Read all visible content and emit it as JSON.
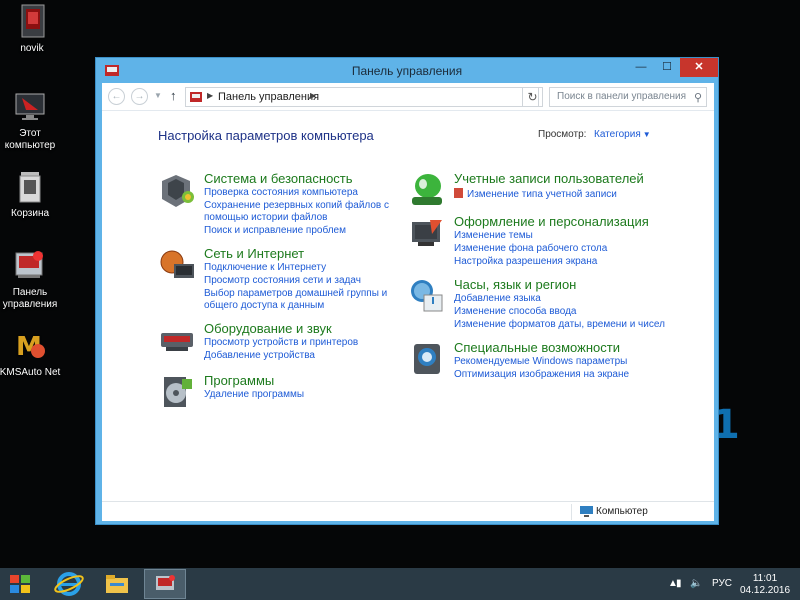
{
  "desktop": {
    "icons": [
      {
        "label": "novik"
      },
      {
        "label": "Этот компьютер"
      },
      {
        "label": "Корзина"
      },
      {
        "label": "Панель управления"
      },
      {
        "label": "KMSAuto Net"
      }
    ]
  },
  "window": {
    "title": "Панель управления",
    "controls": {
      "minimize": "—",
      "maximize": "☐",
      "close": "✕"
    }
  },
  "navbar": {
    "address": {
      "breadcrumb": "Панель управления"
    },
    "search": {
      "placeholder": "Поиск в панели управления"
    }
  },
  "content": {
    "heading": "Настройка параметров компьютера",
    "view_by": {
      "label": "Просмотр:",
      "value": "Категория"
    },
    "categories": [
      {
        "title": "Система и безопасность",
        "icon": "system-security-icon",
        "links": [
          "Проверка состояния компьютера",
          "Сохранение резервных копий файлов с",
          "помощью истории файлов",
          "Поиск и исправление проблем"
        ]
      },
      {
        "title": "Сеть и Интернет",
        "icon": "network-internet-icon",
        "links": [
          "Подключение к Интернету",
          "Просмотр состояния сети и задач",
          "Выбор параметров домашней группы и",
          "общего доступа к данным"
        ]
      },
      {
        "title": "Оборудование и звук",
        "icon": "hardware-sound-icon",
        "links": [
          "Просмотр устройств и принтеров",
          "Добавление устройства"
        ]
      },
      {
        "title": "Программы",
        "icon": "programs-icon",
        "links": [
          "Удаление программы"
        ]
      },
      {
        "title": "Учетные записи пользователей",
        "icon": "user-accounts-icon",
        "links": [
          "Изменение типа учетной записи"
        ]
      },
      {
        "title": "Оформление и персонализация",
        "icon": "appearance-icon",
        "links": [
          "Изменение темы",
          "Изменение фона рабочего стола",
          "Настройка разрешения экрана"
        ]
      },
      {
        "title": "Часы, язык и регион",
        "icon": "clock-language-icon",
        "links": [
          "Добавление языка",
          "Изменение способа ввода",
          "Изменение форматов даты, времени и чисел"
        ]
      },
      {
        "title": "Специальные возможности",
        "icon": "ease-of-access-icon",
        "links": [
          "Рекомендуемые Windows параметры",
          "Оптимизация изображения на экране"
        ]
      }
    ]
  },
  "statusbar": {
    "label": "Компьютер"
  },
  "taskbar": {
    "tray": {
      "language": "РУС",
      "time": "11:01",
      "date": "04.12.2016"
    }
  },
  "colors": {
    "window_frame": "#5fb3e8",
    "close_button": "#c7352c",
    "category_title": "#1d7a1d",
    "link": "#1e5bd6"
  }
}
